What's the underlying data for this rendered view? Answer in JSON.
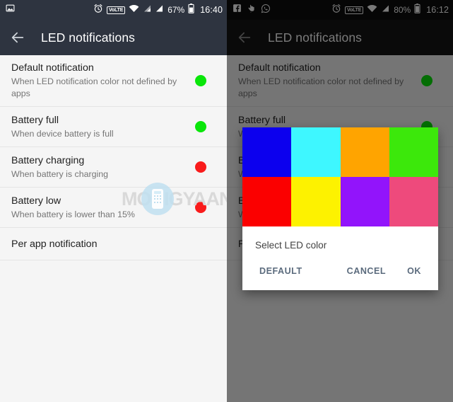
{
  "colors": {
    "statusbar_left": "#2e3440",
    "statusbar_right": "#0d0d0d",
    "toolbar_left": "#2e3440",
    "toolbar_right": "#151515",
    "list_bg": "#f5f5f5",
    "title_text": "#212121",
    "sub_text": "#757575",
    "accent_button": "#5b6b7d",
    "led_green": "#0ae60a",
    "led_red": "#f91b1b",
    "scrim": "rgba(0,0,0,0.52)"
  },
  "left_phone": {
    "statusbar": {
      "left_icons": [
        "image-icon"
      ],
      "alarm_icon": "alarm-clock-icon",
      "volte_label": "VoLTE",
      "wifi_icon": "wifi-icon",
      "signal_icons": [
        "signal-bars-icon",
        "signal-bars-icon"
      ],
      "battery_percent": "67%",
      "battery_icon": "battery-icon",
      "time": "16:40"
    },
    "toolbar": {
      "back_icon": "back-arrow-icon",
      "title": "LED notifications"
    },
    "rows": [
      {
        "title": "Default notification",
        "subtitle": "When LED notification color not defined by apps",
        "dot": "#0ae60a"
      },
      {
        "title": "Battery full",
        "subtitle": "When device battery is full",
        "dot": "#0ae60a"
      },
      {
        "title": "Battery charging",
        "subtitle": "When battery is charging",
        "dot": "#f91b1b"
      },
      {
        "title": "Battery low",
        "subtitle": "When battery is lower than 15%",
        "dot": "#f91b1b"
      },
      {
        "title": "Per app notification",
        "subtitle": "",
        "dot": ""
      }
    ]
  },
  "watermark": {
    "text": "MOBIGYAAN",
    "icon": "mobile-phone-badge-icon"
  },
  "right_phone": {
    "statusbar": {
      "notification_icons": [
        "facebook-icon",
        "hand-tap-icon",
        "whatsapp-icon"
      ],
      "alarm_icon": "alarm-clock-icon",
      "volte_label": "VoLTE",
      "wifi_icon": "wifi-icon",
      "signal_icons": [
        "signal-bars-icon"
      ],
      "battery_percent": "80%",
      "battery_icon": "battery-icon",
      "time": "16:12"
    },
    "toolbar": {
      "back_icon": "back-arrow-icon",
      "title": "LED notifications"
    },
    "rows": [
      {
        "title": "Default notification",
        "subtitle": "When LED notification color not defined by apps",
        "dot": "#0ae60a"
      },
      {
        "title": "Battery full",
        "subtitle": "When device battery is full",
        "dot": "#0ae60a"
      },
      {
        "title": "Battery charging",
        "subtitle": "When battery is charging",
        "dot": "#f91b1b"
      },
      {
        "title": "Battery low",
        "subtitle": "When battery is lower than 15%",
        "dot": "#f91b1b"
      },
      {
        "title": "Per app notification",
        "subtitle": "",
        "dot": ""
      }
    ],
    "dialog": {
      "title": "Select LED color",
      "swatches": [
        {
          "name": "blue",
          "hex": "#0c00ee"
        },
        {
          "name": "cyan",
          "hex": "#3ef7ff"
        },
        {
          "name": "orange",
          "hex": "#ffa400"
        },
        {
          "name": "green",
          "hex": "#3ce80b"
        },
        {
          "name": "red",
          "hex": "#fb0000"
        },
        {
          "name": "yellow",
          "hex": "#fdf200"
        },
        {
          "name": "purple",
          "hex": "#9214fb"
        },
        {
          "name": "pink",
          "hex": "#ee4a7c"
        }
      ],
      "buttons": {
        "default_label": "DEFAULT",
        "cancel_label": "CANCEL",
        "ok_label": "OK"
      }
    }
  }
}
